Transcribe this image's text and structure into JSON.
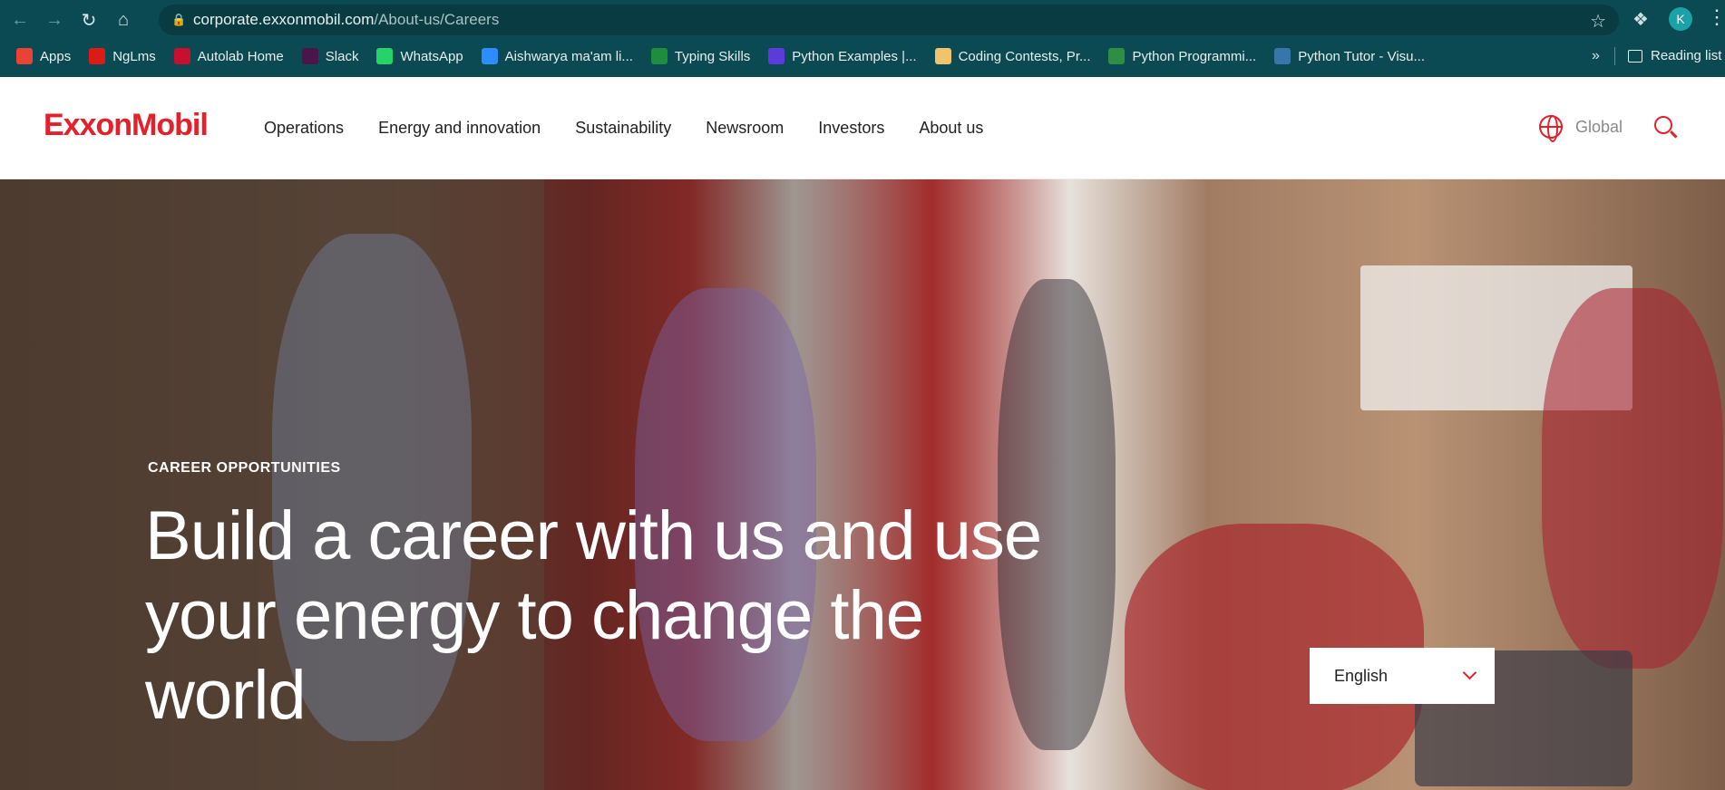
{
  "browser": {
    "url_domain": "corporate.exxonmobil.com",
    "url_path": "/About-us/Careers",
    "profile_initial": "K",
    "bookmarks": [
      {
        "label": "Apps",
        "icon": "apps-grid-icon",
        "color": "#ea4335"
      },
      {
        "label": "NgLms",
        "icon": "angular-icon",
        "color": "#dd1b16"
      },
      {
        "label": "Autolab Home",
        "icon": "autolab-icon",
        "color": "#c8102e"
      },
      {
        "label": "Slack",
        "icon": "slack-icon",
        "color": "#4a154b"
      },
      {
        "label": "WhatsApp",
        "icon": "whatsapp-icon",
        "color": "#25d366"
      },
      {
        "label": "Aishwarya ma'am li...",
        "icon": "zoom-icon",
        "color": "#2d8cff"
      },
      {
        "label": "Typing Skills",
        "icon": "classroom-icon",
        "color": "#1e8e3e"
      },
      {
        "label": "Python Examples |...",
        "icon": "programiz-icon",
        "color": "#5b3bdb"
      },
      {
        "label": "Coding Contests, Pr...",
        "icon": "codechef-icon",
        "color": "#f0c36d"
      },
      {
        "label": "Python Programmi...",
        "icon": "gfg-icon",
        "color": "#2f8d46"
      },
      {
        "label": "Python Tutor - Visu...",
        "icon": "python-icon",
        "color": "#3776ab"
      }
    ],
    "more_label": "»",
    "reading_list_label": "Reading list"
  },
  "site": {
    "logo_text": "ExxonMobil",
    "nav": [
      "Operations",
      "Energy and innovation",
      "Sustainability",
      "Newsroom",
      "Investors",
      "About us"
    ],
    "global_label": "Global"
  },
  "hero": {
    "kicker": "CAREER OPPORTUNITIES",
    "title": "Build a career with us and use your energy to change the world",
    "language_selected": "English"
  },
  "colors": {
    "brand": "#e4202b",
    "chrome": "#0b4a52"
  }
}
